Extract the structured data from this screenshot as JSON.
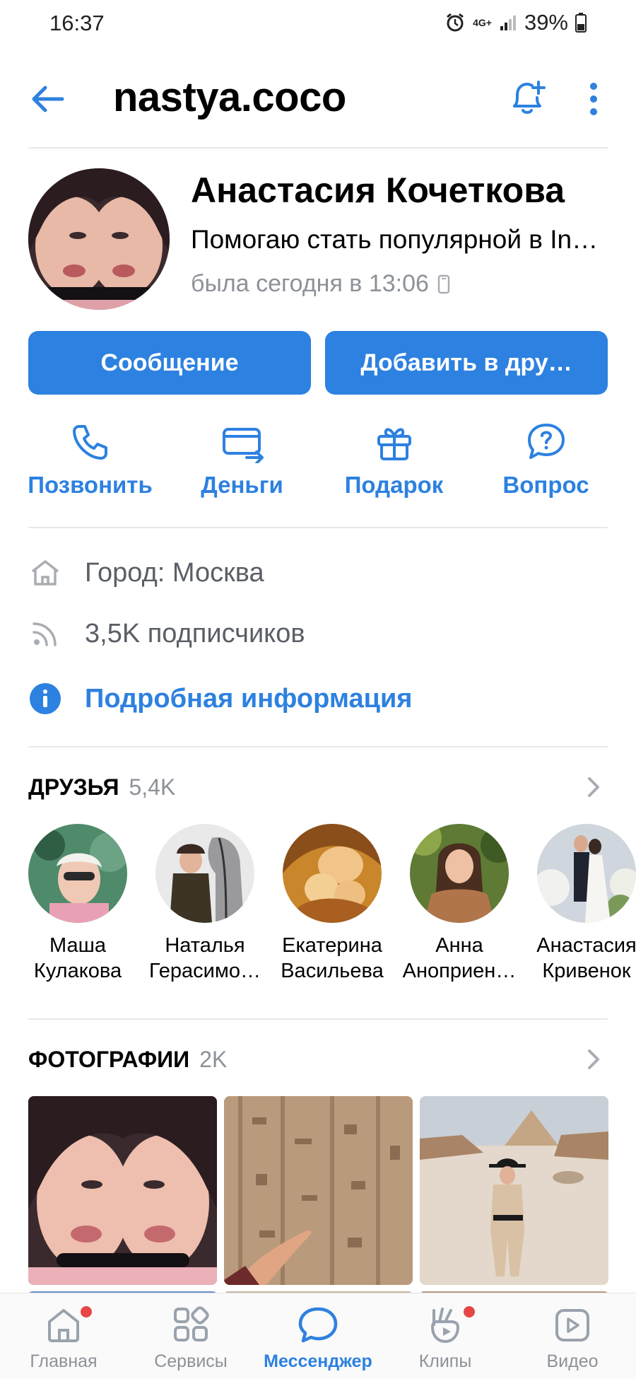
{
  "status_bar": {
    "time": "16:37",
    "network": "4G+",
    "battery": "39%"
  },
  "header": {
    "username": "nastya.coco"
  },
  "profile": {
    "name": "Анастасия Кочеткова",
    "status": "Помогаю стать популярной в Instagram",
    "last_seen": "была сегодня в 13:06"
  },
  "actions": {
    "message": "Сообщение",
    "add_friend": "Добавить в дру…"
  },
  "quick_actions": [
    {
      "label": "Позвонить",
      "icon": "phone-icon"
    },
    {
      "label": "Деньги",
      "icon": "money-card-icon"
    },
    {
      "label": "Подарок",
      "icon": "gift-icon"
    },
    {
      "label": "Вопрос",
      "icon": "question-bubble-icon"
    }
  ],
  "info": {
    "city": "Город: Москва",
    "followers": "3,5K подписчиков",
    "details": "Подробная информация"
  },
  "friends": {
    "title": "ДРУЗЬЯ",
    "count": "5,4K",
    "items": [
      {
        "first": "Маша",
        "last": "Кулакова"
      },
      {
        "first": "Наталья",
        "last": "Герасимо…"
      },
      {
        "first": "Екатерина",
        "last": "Васильева"
      },
      {
        "first": "Анна",
        "last": "Аноприен…"
      },
      {
        "first": "Анастасия",
        "last": "Кривенок"
      }
    ]
  },
  "photos": {
    "title": "ФОТОГРАФИИ",
    "count": "2K"
  },
  "bottom_nav": [
    {
      "label": "Главная",
      "icon": "home-icon"
    },
    {
      "label": "Сервисы",
      "icon": "services-grid-icon"
    },
    {
      "label": "Мессенджер",
      "icon": "messenger-bubble-icon"
    },
    {
      "label": "Клипы",
      "icon": "clips-icon"
    },
    {
      "label": "Видео",
      "icon": "video-icon"
    }
  ],
  "colors": {
    "accent": "#2d81e0",
    "secondary_text": "#8d9299",
    "badge": "#e64646"
  }
}
